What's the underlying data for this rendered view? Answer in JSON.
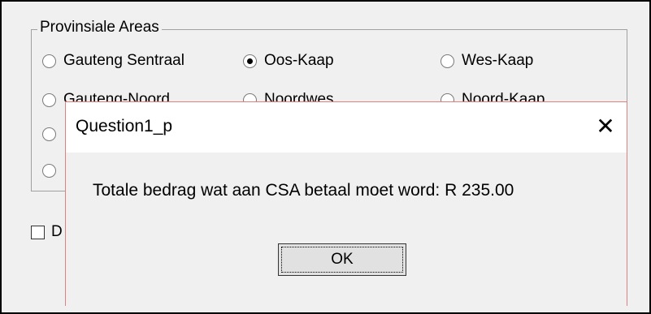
{
  "group": {
    "title": "Provinsiale Areas",
    "radios": [
      {
        "label": "Gauteng Sentraal",
        "checked": false
      },
      {
        "label": "Oos-Kaap",
        "checked": true
      },
      {
        "label": "Wes-Kaap",
        "checked": false
      },
      {
        "label": "Gauteng-Noord",
        "checked": false
      },
      {
        "label": "Noordwes",
        "checked": false
      },
      {
        "label": "Noord-Kaap",
        "checked": false
      },
      {
        "label": "",
        "checked": false
      },
      {
        "label": "",
        "checked": false
      }
    ]
  },
  "checkbox": {
    "label": "D",
    "checked": false
  },
  "dialog": {
    "title": "Question1_p",
    "close_glyph": "✕",
    "message": "Totale bedrag wat aan CSA betaal moet word: R 235.00",
    "ok_label": "OK"
  }
}
